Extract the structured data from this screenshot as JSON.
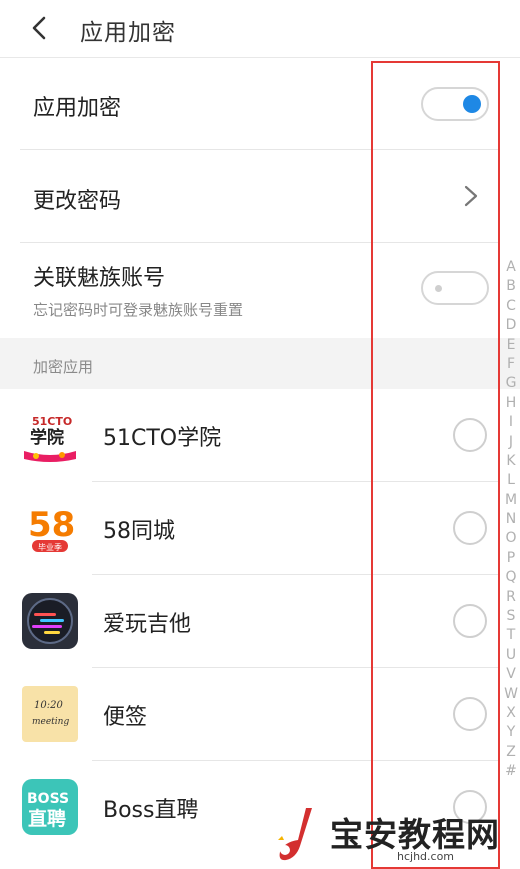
{
  "header": {
    "title": "应用加密",
    "back_icon": "chevron-left-icon"
  },
  "settings": {
    "app_lock": {
      "label": "应用加密",
      "enabled": true
    },
    "change_password": {
      "label": "更改密码"
    },
    "link_account": {
      "label": "关联魅族账号",
      "subtitle": "忘记密码时可登录魅族账号重置",
      "enabled": false
    }
  },
  "section": {
    "title": "加密应用"
  },
  "apps": [
    {
      "name": "51CTO学院",
      "icon": "51cto-app-icon",
      "icon_text": "51CTO",
      "icon_text2": "学院"
    },
    {
      "name": "58同城",
      "icon": "58-city-app-icon",
      "icon_text": "58",
      "icon_text2": "毕业季"
    },
    {
      "name": "爱玩吉他",
      "icon": "guitar-app-icon"
    },
    {
      "name": "便签",
      "icon": "notes-app-icon",
      "icon_text": "10:20",
      "icon_text2": "meeting"
    },
    {
      "name": "Boss直聘",
      "icon": "boss-app-icon",
      "icon_text": "BOSS",
      "icon_text2": "直聘"
    }
  ],
  "alphabet": [
    "A",
    "B",
    "C",
    "D",
    "E",
    "F",
    "G",
    "H",
    "I",
    "J",
    "K",
    "L",
    "M",
    "N",
    "O",
    "P",
    "Q",
    "R",
    "S",
    "T",
    "U",
    "V",
    "W",
    "X",
    "Y",
    "Z",
    "#"
  ],
  "watermark": {
    "text": "宝安教程网",
    "url": "hcjhd.com"
  },
  "colors": {
    "accent": "#1e88e5",
    "highlight": "#e53935"
  }
}
